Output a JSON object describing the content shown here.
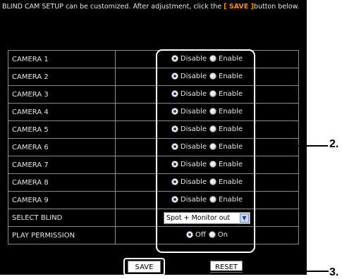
{
  "intro": {
    "text_before": "BLIND CAM SETUP can be customized. After adjustment, click the ",
    "save_highlight": "[ SAVE ]",
    "text_after": "button below."
  },
  "options": {
    "disable": "Disable",
    "enable": "Enable",
    "off": "Off",
    "on": "On"
  },
  "rows": [
    {
      "label": "CAMERA 1",
      "selected": "Disable"
    },
    {
      "label": "CAMERA 2",
      "selected": "Disable"
    },
    {
      "label": "CAMERA 3",
      "selected": "Disable"
    },
    {
      "label": "CAMERA 4",
      "selected": "Disable"
    },
    {
      "label": "CAMERA 5",
      "selected": "Disable"
    },
    {
      "label": "CAMERA 6",
      "selected": "Disable"
    },
    {
      "label": "CAMERA 7",
      "selected": "Disable"
    },
    {
      "label": "CAMERA 8",
      "selected": "Disable"
    },
    {
      "label": "CAMERA 9",
      "selected": "Disable"
    }
  ],
  "select_blind": {
    "label": "SELECT BLIND",
    "value": "Spot + Monitor out"
  },
  "play_permission": {
    "label": "PLAY PERMISSION",
    "selected": "Off"
  },
  "buttons": {
    "save": "SAVE",
    "reset": "RESET"
  },
  "callouts": {
    "controls": "2.",
    "save": "3."
  }
}
